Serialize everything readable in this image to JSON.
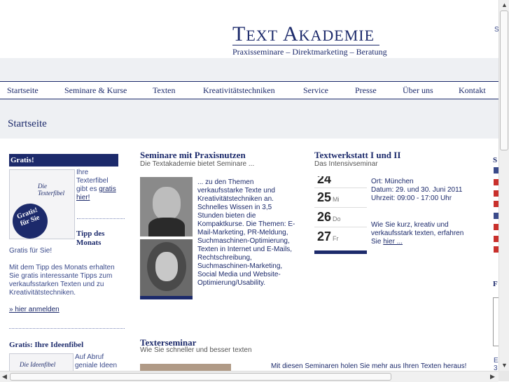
{
  "header": {
    "logo_t": "T",
    "logo_ext": "EXT",
    "logo_a": "A",
    "logo_kademie": "KADEMIE",
    "logo_subtitle": "Praxisseminare – Direktmarketing – Beratung",
    "edge_text": "S"
  },
  "nav": {
    "items": [
      "Startseite",
      "Seminare & Kurse",
      "Texten",
      "Kreativitätstechniken",
      "Service",
      "Presse",
      "Über uns",
      "Kontakt"
    ]
  },
  "page": {
    "title": "Startseite"
  },
  "left": {
    "gratis_head": "Gratis!",
    "gratis_text_1": "Ihre Texterfibel gibt es",
    "gratis_link": "gratis hier!",
    "book_title": "Die Texterfibel",
    "badge": "Gratis! für Sie",
    "tipp_head": "Tipp des Monats",
    "tipp_sub": "Gratis für Sie!",
    "tipp_text": "Mit dem Tipp des Monats erhalten Sie gratis interessante Tipps zum verkaufsstarken Texten und zu Kreativitätstechniken.",
    "tipp_link": "» hier anmelden",
    "ideen_head": "Gratis: Ihre Ideenfibel",
    "ideen_book_title": "Die Ideenfibel",
    "ideen_text": "Auf Abruf geniale Ideen"
  },
  "middle": {
    "heading": "Seminare mit Praxisnutzen",
    "subheading": "Die Textakademie bietet Seminare ...",
    "body": "... zu den Themen verkaufsstarke Texte und Kreativitätstechniken an. Schnelles Wissen in 3,5 Stunden bieten die Kompaktkurse. Die Themen: E-Mail-Marketing, PR-Meldung, Suchmaschinen-Optimierung, Texten in Internet und E-Mails, Rechtschreibung, Suchmaschinen-Marketing, Social Media und Website-Optimierung/Usability.",
    "texter_heading": "Texterseminar",
    "texter_sub": "Wie Sie schneller und besser texten"
  },
  "right": {
    "heading": "Textwerkstatt I und II",
    "subheading": "Das Intensivseminar",
    "ort": "Ort: München",
    "datum": "Datum: 29. und 30. Juni 2011",
    "uhrzeit": "Uhrzeit: 09:00 - 17:00 Uhr",
    "body": "Wie Sie kurz, kreativ und verkaufsstark texten, erfahren Sie",
    "link": "hier ...",
    "bottom_line": "Mit diesen Seminaren holen Sie mehr aus Ihren Texten heraus!",
    "cal_days": [
      "24",
      "25",
      "26",
      "27"
    ],
    "cal_marks": [
      "",
      "Mi",
      "Do",
      "Fr"
    ]
  },
  "edge": {
    "s_head": "S",
    "f_head": "F",
    "e_text": "E",
    "num": "3"
  },
  "colors": {
    "brand": "#1c2a6b",
    "band": "#eef0f3"
  },
  "icons": [
    "pdf-icon",
    "chevron-up-icon",
    "chevron-down-icon",
    "chevron-left-icon",
    "chevron-right-icon"
  ]
}
